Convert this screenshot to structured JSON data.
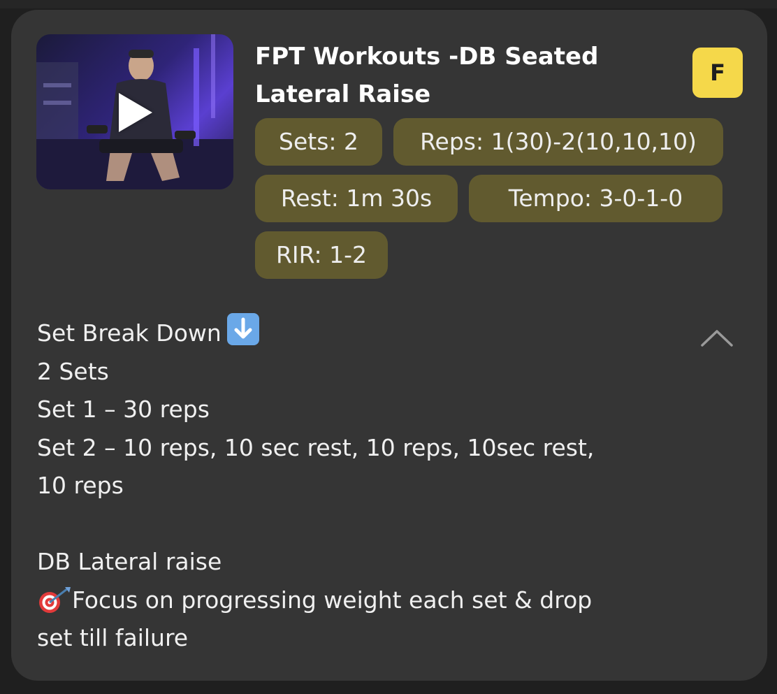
{
  "exercise": {
    "title": "FPT Workouts -DB Seated Lateral Raise",
    "avatar_letter": "F",
    "chips": {
      "sets": "Sets: 2",
      "reps": "Reps: 1(30)-2(10,10,10)",
      "rest": "Rest: 1m 30s",
      "tempo": "Tempo: 3-0-1-0",
      "rir": "RIR: 1-2"
    }
  },
  "description": {
    "heading": "Set Break Down",
    "lines": [
      "2 Sets",
      "Set 1 – 30 reps",
      "Set 2 – 10 reps, 10 sec rest, 10 reps, 10sec rest,",
      "10 reps"
    ],
    "sub_heading": "DB Lateral raise",
    "focus_line1": "Focus on progressing weight each set & drop",
    "focus_line2": "set till failure"
  },
  "icons": {
    "play": "play-icon",
    "heading_emoji": "down-arrow-button-icon",
    "focus_emoji": "direct-hit-target-icon",
    "collapse": "chevron-up-icon"
  },
  "colors": {
    "card_bg": "#353535",
    "chip_bg": "#615a2f",
    "avatar_bg": "#f5d84a",
    "video_tint": "#5a3fd0"
  }
}
